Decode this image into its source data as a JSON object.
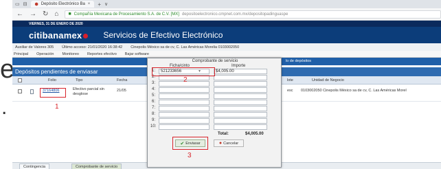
{
  "slide": {
    "letter": "e",
    "dot": "."
  },
  "browser": {
    "tab_title": "Depósito Electrónico Ba",
    "tab_close": "×",
    "tab_new": "+",
    "tab_chevron": "∨",
    "nav_back": "←",
    "nav_forward": "→",
    "nav_reload": "↻",
    "nav_home": "⌂",
    "site_name": "Compañía Mexicana de Procesamiento S.A. de C.V. [MX]",
    "url": "depositoelectronico.cmpnet.com.mx/depositopadinguaspe"
  },
  "bank": {
    "date_line": "VIERNES, 31 DE ENERO DE 2020",
    "brand": "citibanamex",
    "title": "Servicios de Efectivo Electrónico",
    "info": {
      "user": "Auxiliar de Valores 305",
      "last_access": "Último acceso: 21/01/2020 16:38:42",
      "location": "Cinepolis México sa de cv, C. Las Américas Morelia 0103002050"
    },
    "menu": [
      "Principal",
      "Operación",
      "Monitoreo",
      "Reportes efectivo",
      "Bajar software"
    ],
    "strip_label": "lo de depósitos"
  },
  "section_title": "Depósitos pendientes de enviasar",
  "table": {
    "headers": {
      "folio": "Folio",
      "tipo": "Tipo",
      "fecha": "Fecha",
      "lote": "lote",
      "unidad": "Unidad de Negocio"
    },
    "rows": [
      {
        "folio": "37164806",
        "tipo": "Efectivo parcial sin desglose",
        "fecha": "21/05",
        "lote": "esc",
        "unidad": "0103002050 Cinepolis México sa de cv, C. Las Américas Morel"
      }
    ]
  },
  "modal": {
    "title": "Comprobante de servicio",
    "col_ficha": "Ficha/cinto",
    "col_importe": "Importe",
    "rows": [
      {
        "n": "1:",
        "ficha": "521233656",
        "importe": "$4,005.00"
      },
      {
        "n": "2:",
        "ficha": "",
        "importe": ""
      },
      {
        "n": "3:",
        "ficha": "",
        "importe": ""
      },
      {
        "n": "4:",
        "ficha": "",
        "importe": ""
      },
      {
        "n": "5:",
        "ficha": "",
        "importe": ""
      },
      {
        "n": "6:",
        "ficha": "",
        "importe": ""
      },
      {
        "n": "7:",
        "ficha": "",
        "importe": ""
      },
      {
        "n": "8:",
        "ficha": "",
        "importe": ""
      },
      {
        "n": "9:",
        "ficha": "",
        "importe": ""
      },
      {
        "n": "10:",
        "ficha": "",
        "importe": ""
      }
    ],
    "total_label": "Total:",
    "total_value": "$4,005.00",
    "send_label": "Enviasar",
    "cancel_label": "Cancelar"
  },
  "annotations": [
    "1",
    "2",
    "3"
  ],
  "bottom_tabs": [
    "Contingencia",
    "Comprobante de servicio"
  ],
  "colors": {
    "brand_blue": "#0c3d7a",
    "annotation_red": "#d8232a",
    "accent_blue": "#2e6bb0"
  }
}
